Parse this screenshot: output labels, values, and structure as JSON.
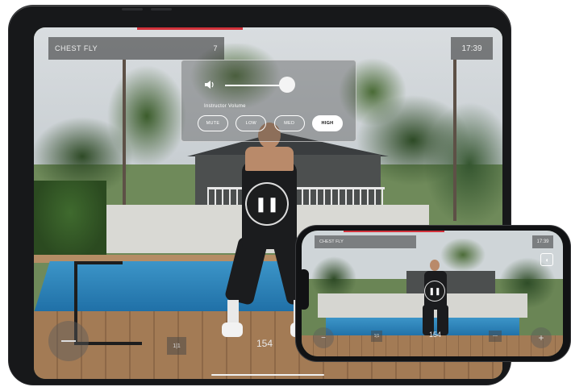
{
  "tablet": {
    "exercise_title": "CHEST FLY",
    "set_counter": "7",
    "clock": "17:39",
    "progress_fraction": 0.41,
    "volume": {
      "speaker_icon": "speaker-icon",
      "level_fraction": 0.86,
      "label": "Instructor Volume",
      "options": [
        "MUTE",
        "LOW",
        "MED",
        "HIGH"
      ],
      "selected": "HIGH"
    },
    "pause_glyph": "❚❚",
    "weight_label": "1|1",
    "rep_count": "154"
  },
  "phone": {
    "exercise_title": "CHEST FLY",
    "clock": "17:39",
    "volume_icon": "speaker-icon",
    "volume_glyph": "◖",
    "pause_glyph": "❚❚",
    "left_glyph": "−",
    "right_glyph": "+",
    "weight_label": "1|1",
    "rep_count": "154",
    "weight_right": "—",
    "progress_fraction": 0.7
  },
  "colors": {
    "accent": "#d2323b",
    "overlay": "#282828",
    "text": "#ffffff"
  }
}
